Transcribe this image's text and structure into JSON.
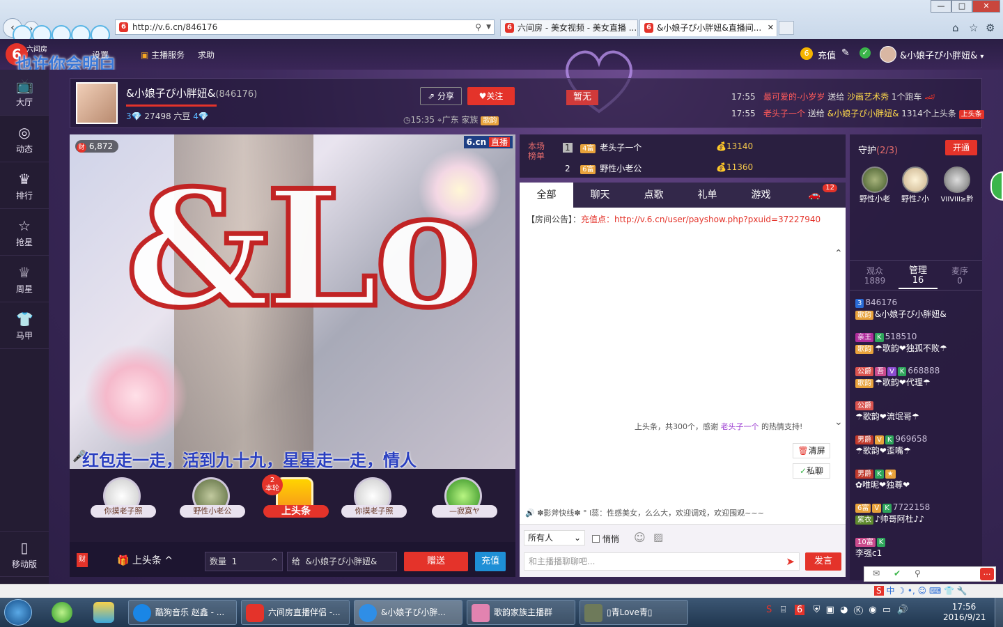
{
  "browser": {
    "url": "http://v.6.cn/846176",
    "tabs": [
      {
        "title": "六间房 - 美女视频 - 美女直播 ..."
      },
      {
        "title": "&小娘子ぴ小胖妞&直播间..."
      }
    ],
    "window_buttons": [
      "—",
      "□",
      "✕"
    ]
  },
  "site": {
    "logo_text": "六间房",
    "overlay_text": "也许你会明白",
    "header_links": [
      "设置",
      "主播服务",
      "求助"
    ],
    "recharge": "充值",
    "user_name": "&小娘子ぴ小胖妞&",
    "user_dropdown": "▾"
  },
  "sidebar": {
    "items": [
      {
        "label": "大厅",
        "icon": "tv-icon"
      },
      {
        "label": "动态",
        "icon": "compass-icon"
      },
      {
        "label": "排行",
        "icon": "crown-icon"
      },
      {
        "label": "抢星",
        "icon": "star-icon"
      },
      {
        "label": "周星",
        "icon": "cup-icon"
      },
      {
        "label": "马甲",
        "icon": "shirt-icon"
      }
    ],
    "mobile": "移动版"
  },
  "anchor": {
    "name": "&小娘子ぴ小胖妞&",
    "room_id": "(846176)",
    "level_left": "3",
    "beans": "27498 六豆",
    "level_right": "4",
    "time": "15:35",
    "location": "广东",
    "family_label": "家族",
    "family_badge": "歌韵",
    "share": "分享",
    "follow": "关注",
    "no_data": "暂无"
  },
  "feed": [
    {
      "time": "17:55",
      "from": "最可爱的-小岁岁",
      "verb": "送给",
      "to": "沙画艺术秀",
      "gift": "1个跑车"
    },
    {
      "time": "17:55",
      "from": "老头子一个",
      "verb": "送给",
      "to": "&小娘子ぴ小胖妞&",
      "gift": "1314个上头条"
    }
  ],
  "video": {
    "fortune_count": "6,872",
    "brand": "6.cn",
    "live": "直播",
    "scroll_text": "红包走一走，活到九十九，星星走一走，情人"
  },
  "gifts": [
    {
      "label": "你摸老子照"
    },
    {
      "label": "野性小老公"
    },
    {
      "label": "上头条",
      "round": "2",
      "round_label": "本轮"
    },
    {
      "label": "你摸老子照"
    },
    {
      "label": "—寂寞ヤ"
    }
  ],
  "send_bar": {
    "fortune": "财",
    "gift_name": "上头条",
    "qty_label": "数量",
    "qty": "1",
    "to_label": "给",
    "to_name": "&小娘子ぴ小胖妞&",
    "send": "赠送",
    "recharge": "充值"
  },
  "ranking": {
    "title": "本场榜单",
    "rows": [
      {
        "rank": "1",
        "level": "4富",
        "name": "老头子一个",
        "value": "13140"
      },
      {
        "rank": "2",
        "level": "6富",
        "name": "野性小老公",
        "value": "11360"
      }
    ]
  },
  "chat": {
    "tabs": [
      "全部",
      "聊天",
      "点歌",
      "礼单",
      "游戏"
    ],
    "car_badge": "12",
    "notice_label": "【房间公告】：",
    "notice_prefix": "充值点：",
    "notice_url": "http://v.6.cn/user/payshow.php?pxuid=37227940",
    "gift_msg_a": "上头条，共300个，感谢",
    "gift_msg_user": "老头子一个",
    "gift_msg_b": "的热情支持!",
    "clear": "清屏",
    "private": "私聊",
    "marquee": "✽影斧快线✽ ° l蕊：性感美女，么么大，欢迎调戏，欢迎围观~~~",
    "recipient": "所有人",
    "whisper": "悄悄",
    "input_placeholder": "和主播播聊聊吧...",
    "send": "发言",
    "gift_tag": "上头条"
  },
  "guard": {
    "title": "守护",
    "count": "(2/3)",
    "open": "开通",
    "members": [
      "野性小老",
      "野性♪小",
      "VIIVIII≥黔"
    ]
  },
  "audience_tabs": [
    {
      "label": "观众",
      "count": "1889"
    },
    {
      "label": "管理",
      "count": "16"
    },
    {
      "label": "麦序",
      "count": "0"
    }
  ],
  "admins": [
    {
      "badges": [
        "3"
      ],
      "id": "846176",
      "line2_badge": "歌韵",
      "line2": "&小娘子ぴ小胖妞&"
    },
    {
      "badges": [
        "亲王",
        "K"
      ],
      "id": "518510",
      "line2_badge": "歌韵",
      "line2": "☂歌韵❤独孤不败☂"
    },
    {
      "badges": [
        "公爵",
        "吾",
        "V",
        "K"
      ],
      "id": "668888",
      "line2_badge": "歌韵",
      "line2": "☂歌韵❤代理☂"
    },
    {
      "badges": [
        "公爵"
      ],
      "id": "",
      "line2_badge": "",
      "line2": "☂歌韵❤流氓哥☂"
    },
    {
      "badges": [
        "男爵",
        "V",
        "K"
      ],
      "id": "969658",
      "line2_badge": "",
      "line2": "☂歌韵❤歪嘴☂"
    },
    {
      "badges": [
        "男爵",
        "K",
        "★"
      ],
      "id": "",
      "line2_badge": "",
      "line2": "✿唯昵❤独尊❤"
    },
    {
      "badges": [
        "6富",
        "V",
        "K"
      ],
      "id": "7722158",
      "line2_badge": "紫衣",
      "line2": "♪帅哥阿杜♪♪"
    },
    {
      "badges": [
        "10富",
        "K"
      ],
      "id": "",
      "line2_badge": "",
      "line2": "李强c1"
    }
  ],
  "taskbar": {
    "items": [
      {
        "label": "酷狗音乐 赵鑫 - ..."
      },
      {
        "label": "六间房直播伴侣 -..."
      },
      {
        "label": "&小娘子ぴ小胖..."
      },
      {
        "label": "歌韵家族主播群"
      },
      {
        "label": "▯青Love青▯"
      }
    ],
    "time": "17:56",
    "date": "2016/9/21",
    "ime": "中"
  },
  "colors": {
    "accent": "#e4332a",
    "purple_bg": "#3d2a5c",
    "link": "#ff5a5a",
    "highlight": "#ffd94a"
  }
}
